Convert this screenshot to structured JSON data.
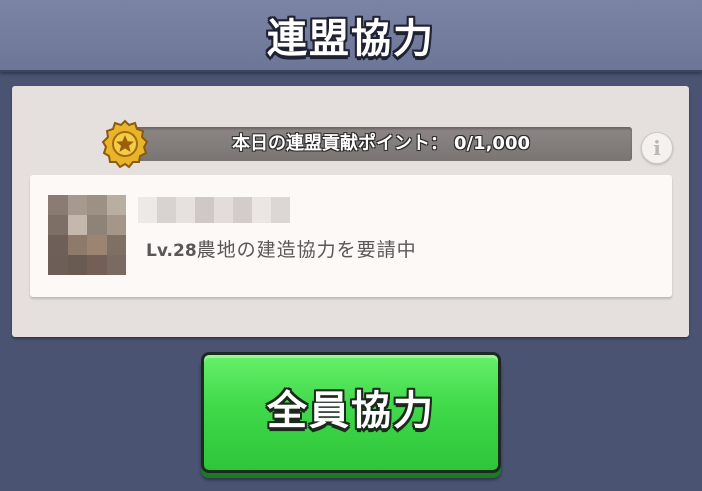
{
  "header": {
    "title": "連盟協力"
  },
  "points": {
    "label": "本日の連盟貢献ポイント：",
    "value": "0/1,000",
    "progress_fraction": 0
  },
  "request": {
    "level": "Lv.28",
    "text": "農地の建造協力を要請中"
  },
  "actions": {
    "cooperate_all_label": "全員協力"
  },
  "colors": {
    "background": "#4b5373",
    "header": "#737c9c",
    "panel": "#e5e0dd",
    "card": "#fcf9f7",
    "button_green": "#3fd94a",
    "medal_gold": "#e8b42a"
  },
  "icons": {
    "medal": "medal-icon",
    "info": "info-icon"
  }
}
